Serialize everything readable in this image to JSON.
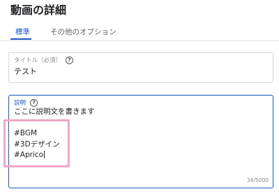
{
  "page": {
    "title": "動画の詳細"
  },
  "tabs": [
    {
      "label": "標準",
      "active": true
    },
    {
      "label": "その他のオプション",
      "active": false
    }
  ],
  "title_field": {
    "label": "タイトル（必須）",
    "value": "テスト",
    "help_icon": "question-mark-circle-icon"
  },
  "description_field": {
    "label": "説明",
    "help_icon": "question-mark-circle-icon",
    "lines": [
      "ここに説明文を書きます",
      "",
      "#BGM",
      "#3Dデザイン",
      "#Aprico"
    ],
    "counter": "34/5000"
  },
  "colors": {
    "accent": "#1a55c4",
    "highlight": "#f0a6c7"
  }
}
